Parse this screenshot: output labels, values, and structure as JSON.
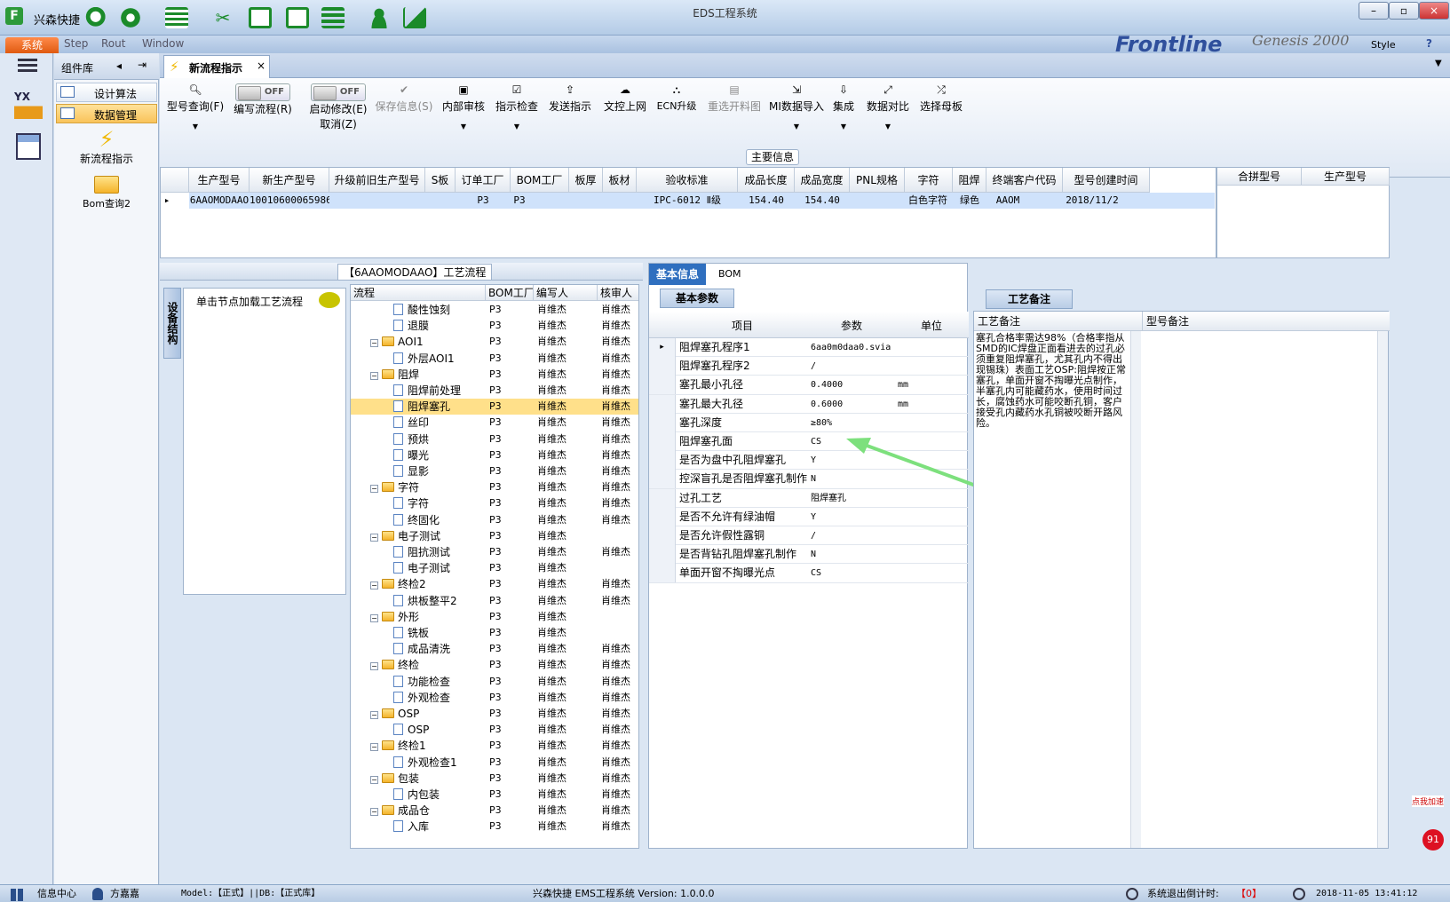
{
  "app": {
    "name": "兴森快捷",
    "window_title": "EDS工程系统",
    "system_tab": "系统",
    "menu_items": [
      "Step",
      "Rout",
      "Window"
    ],
    "brand": "Frontline",
    "brand2": "Genesis 2000",
    "style_label": "Style",
    "help_icon": "?"
  },
  "library": {
    "title": "组件库",
    "items": [
      {
        "label": "设计算法"
      },
      {
        "label": "数据管理"
      }
    ],
    "tools": [
      {
        "label": "新流程指示"
      },
      {
        "label": "Bom查询2"
      }
    ]
  },
  "document_tab": {
    "label": "新流程指示",
    "close": "×"
  },
  "ribbon": {
    "buttons": [
      {
        "label": "型号查询(F)",
        "icon": "search-icon"
      },
      {
        "label": "编写流程(R)",
        "toggle": "OFF"
      },
      {
        "label": "启动修改(E)",
        "label2": "取消(Z)",
        "toggle": "OFF"
      },
      {
        "label": "保存信息(S)",
        "icon": "check-icon",
        "disabled": true
      },
      {
        "label": "内部审核",
        "icon": "printer-icon"
      },
      {
        "label": "指示检查",
        "icon": "checkbox-icon"
      },
      {
        "label": "发送指示",
        "icon": "upload-icon"
      },
      {
        "label": "文控上网",
        "icon": "cloud-upload-icon"
      },
      {
        "label": "ECN升级",
        "icon": "ecn-icon"
      },
      {
        "label": "重选开料图",
        "icon": "image-icon",
        "disabled": true
      },
      {
        "label": "MI数据导入",
        "icon": "import-icon"
      },
      {
        "label": "集成",
        "icon": "download-icon"
      },
      {
        "label": "数据对比",
        "icon": "compare-icon"
      },
      {
        "label": "选择母板",
        "icon": "shuffle-icon"
      }
    ],
    "group_title": "主要信息"
  },
  "main_grid": {
    "columns": [
      "生产型号",
      "新生产型号",
      "升级前旧生产型号",
      "S板",
      "订单工厂",
      "BOM工厂",
      "板厚",
      "板材",
      "验收标准",
      "成品长度",
      "成品宽度",
      "PNL规格",
      "字符",
      "阻焊",
      "终端客户代码",
      "型号创建时间"
    ],
    "row": [
      "6AAOMODAAO",
      "10010600065986",
      "",
      "",
      "P3",
      "P3",
      "",
      "",
      "IPC-6012 Ⅱ级",
      "154.40",
      "154.40",
      "",
      "白色字符",
      "绿色",
      "AAOM",
      "2018/11/2"
    ]
  },
  "side_grid": {
    "columns": [
      "合拼型号",
      "生产型号"
    ]
  },
  "process_panel": {
    "title": "【6AAOMODAAO】工艺流程",
    "vertical_tab": "设备结构",
    "node_hint": "单击节点加载工艺流程",
    "columns": [
      "流程",
      "BOM工厂",
      "编写人",
      "核审人"
    ],
    "rows": [
      {
        "name": "酸性蚀刻",
        "level": 2,
        "f": "P3",
        "w": "肖维杰",
        "r": "肖维杰"
      },
      {
        "name": "退膜",
        "level": 2,
        "f": "P3",
        "w": "肖维杰",
        "r": "肖维杰"
      },
      {
        "name": "AOI1",
        "level": 1,
        "f": "P3",
        "w": "肖维杰",
        "r": "肖维杰"
      },
      {
        "name": "外层AOI1",
        "level": 2,
        "f": "P3",
        "w": "肖维杰",
        "r": "肖维杰"
      },
      {
        "name": "阻焊",
        "level": 1,
        "f": "P3",
        "w": "肖维杰",
        "r": "肖维杰"
      },
      {
        "name": "阻焊前处理",
        "level": 2,
        "f": "P3",
        "w": "肖维杰",
        "r": "肖维杰"
      },
      {
        "name": "阻焊塞孔",
        "level": 2,
        "f": "P3",
        "w": "肖维杰",
        "r": "肖维杰",
        "selected": true
      },
      {
        "name": "丝印",
        "level": 2,
        "f": "P3",
        "w": "肖维杰",
        "r": "肖维杰"
      },
      {
        "name": "预烘",
        "level": 2,
        "f": "P3",
        "w": "肖维杰",
        "r": "肖维杰"
      },
      {
        "name": "曝光",
        "level": 2,
        "f": "P3",
        "w": "肖维杰",
        "r": "肖维杰"
      },
      {
        "name": "显影",
        "level": 2,
        "f": "P3",
        "w": "肖维杰",
        "r": "肖维杰"
      },
      {
        "name": "字符",
        "level": 1,
        "f": "P3",
        "w": "肖维杰",
        "r": "肖维杰"
      },
      {
        "name": "字符",
        "level": 2,
        "f": "P3",
        "w": "肖维杰",
        "r": "肖维杰"
      },
      {
        "name": "终固化",
        "level": 2,
        "f": "P3",
        "w": "肖维杰",
        "r": "肖维杰"
      },
      {
        "name": "电子测试",
        "level": 1,
        "f": "P3",
        "w": "肖维杰",
        "r": ""
      },
      {
        "name": "阻抗测试",
        "level": 2,
        "f": "P3",
        "w": "肖维杰",
        "r": "肖维杰"
      },
      {
        "name": "电子测试",
        "level": 2,
        "f": "P3",
        "w": "肖维杰",
        "r": ""
      },
      {
        "name": "终检2",
        "level": 1,
        "f": "P3",
        "w": "肖维杰",
        "r": "肖维杰"
      },
      {
        "name": "烘板整平2",
        "level": 2,
        "f": "P3",
        "w": "肖维杰",
        "r": "肖维杰"
      },
      {
        "name": "外形",
        "level": 1,
        "f": "P3",
        "w": "肖维杰",
        "r": ""
      },
      {
        "name": "铣板",
        "level": 2,
        "f": "P3",
        "w": "肖维杰",
        "r": ""
      },
      {
        "name": "成品清洗",
        "level": 2,
        "f": "P3",
        "w": "肖维杰",
        "r": "肖维杰"
      },
      {
        "name": "终检",
        "level": 1,
        "f": "P3",
        "w": "肖维杰",
        "r": "肖维杰"
      },
      {
        "name": "功能检查",
        "level": 2,
        "f": "P3",
        "w": "肖维杰",
        "r": "肖维杰"
      },
      {
        "name": "外观检查",
        "level": 2,
        "f": "P3",
        "w": "肖维杰",
        "r": "肖维杰"
      },
      {
        "name": "OSP",
        "level": 1,
        "f": "P3",
        "w": "肖维杰",
        "r": "肖维杰"
      },
      {
        "name": "OSP",
        "level": 2,
        "f": "P3",
        "w": "肖维杰",
        "r": "肖维杰"
      },
      {
        "name": "终检1",
        "level": 1,
        "f": "P3",
        "w": "肖维杰",
        "r": "肖维杰"
      },
      {
        "name": "外观检查1",
        "level": 2,
        "f": "P3",
        "w": "肖维杰",
        "r": "肖维杰"
      },
      {
        "name": "包装",
        "level": 1,
        "f": "P3",
        "w": "肖维杰",
        "r": "肖维杰"
      },
      {
        "name": "内包装",
        "level": 2,
        "f": "P3",
        "w": "肖维杰",
        "r": "肖维杰"
      },
      {
        "name": "成品仓",
        "level": 1,
        "f": "P3",
        "w": "肖维杰",
        "r": "肖维杰"
      },
      {
        "name": "入库",
        "level": 2,
        "f": "P3",
        "w": "肖维杰",
        "r": "肖维杰"
      }
    ]
  },
  "info_panel": {
    "tabs": [
      "基本信息",
      "BOM"
    ],
    "subtab": "基本参数",
    "columns": [
      "项目",
      "参数",
      "单位"
    ],
    "rows": [
      {
        "item": "阻焊塞孔程序1",
        "value": "6aa0m0daa0.svia",
        "unit": ""
      },
      {
        "item": "阻焊塞孔程序2",
        "value": "/",
        "unit": ""
      },
      {
        "item": "塞孔最小孔径",
        "value": "0.4000",
        "unit": "mm"
      },
      {
        "item": "塞孔最大孔径",
        "value": "0.6000",
        "unit": "mm"
      },
      {
        "item": "塞孔深度",
        "value": "≥80%",
        "unit": ""
      },
      {
        "item": "阻焊塞孔面",
        "value": "CS",
        "unit": ""
      },
      {
        "item": "是否为盘中孔阻焊塞孔",
        "value": "Y",
        "unit": ""
      },
      {
        "item": "控深盲孔是否阻焊塞孔制作",
        "value": "N",
        "unit": ""
      },
      {
        "item": "过孔工艺",
        "value": "阻焊塞孔",
        "unit": ""
      },
      {
        "item": "是否不允许有绿油帽",
        "value": "Y",
        "unit": ""
      },
      {
        "item": "是否允许假性露铜",
        "value": "/",
        "unit": ""
      },
      {
        "item": "是否背钻孔阻焊塞孔制作",
        "value": "N",
        "unit": ""
      },
      {
        "item": "单面开窗不掏曝光点",
        "value": "CS",
        "unit": ""
      }
    ]
  },
  "notes_panel": {
    "tab": "工艺备注",
    "columns": [
      "工艺备注",
      "型号备注"
    ],
    "text": "塞孔合格率需达98%（合格率指从SMD的IC焊盘正面看进去的过孔必须重复阻焊塞孔，尤其孔内不得出现锡珠）表面工艺OSP:阻焊按正常塞孔，单面开窗不掏曝光点制作，半塞孔内可能藏药水，使用时间过长，腐蚀药水可能咬断孔铜，客户接受孔内藏药水孔铜被咬断开路风险。"
  },
  "status": {
    "info_center": "信息中心",
    "user": "方嘉嘉",
    "model": "Model:【正式】||DB:【正式库】",
    "version": "兴森快捷 EMS工程系统 Version: 1.0.0.0",
    "countdown_label": "系统退出倒计时:",
    "countdown_value": "【0】",
    "datetime": "2018-11-05 13:41:12",
    "float_badge": "91",
    "float_label": "点我加速"
  },
  "colors": {
    "accent": "#e05a10",
    "selection": "#ffe08a",
    "arrow": "#7de07d"
  }
}
